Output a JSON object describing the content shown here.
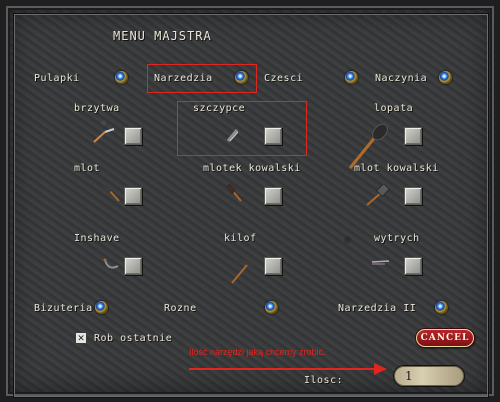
{
  "title": "MENU MAJSTRA",
  "categories": {
    "pulapki": "Pulapki",
    "narzedzia": "Narzedzia",
    "czesci": "Czesci",
    "naczynia": "Naczynia",
    "bizuteria": "Bizuteria",
    "rozne": "Rozne",
    "narzedzia2": "Narzedzia II"
  },
  "items": {
    "brzytwa": "brzytwa",
    "szczypce": "szczypce",
    "lopata": "lopata",
    "mlot": "mlot",
    "mlotek_kowalski": "mlotek kowalski",
    "mlot_kowalski": "mlot kowalski",
    "inshave": "Inshave",
    "kilof": "kilof",
    "wytrych": "wytrych"
  },
  "options": {
    "rob_ostatnie": "Rob ostatnie",
    "rob_ostatnie_checked": true,
    "check_mark": "✕"
  },
  "buttons": {
    "cancel": "CANCEL"
  },
  "quantity": {
    "label": "Ilosc:",
    "value": "1"
  },
  "annotation": {
    "text": "Ilość narzędzi jaką chcemy zrobić.",
    "color": "#e0261f"
  },
  "icons": [
    "gem-icon",
    "razor-icon",
    "pliers-icon",
    "shovel-icon",
    "hammer-icon",
    "smith-hammer-icon",
    "inshave-icon",
    "pickaxe-icon",
    "lockpick-icon"
  ]
}
